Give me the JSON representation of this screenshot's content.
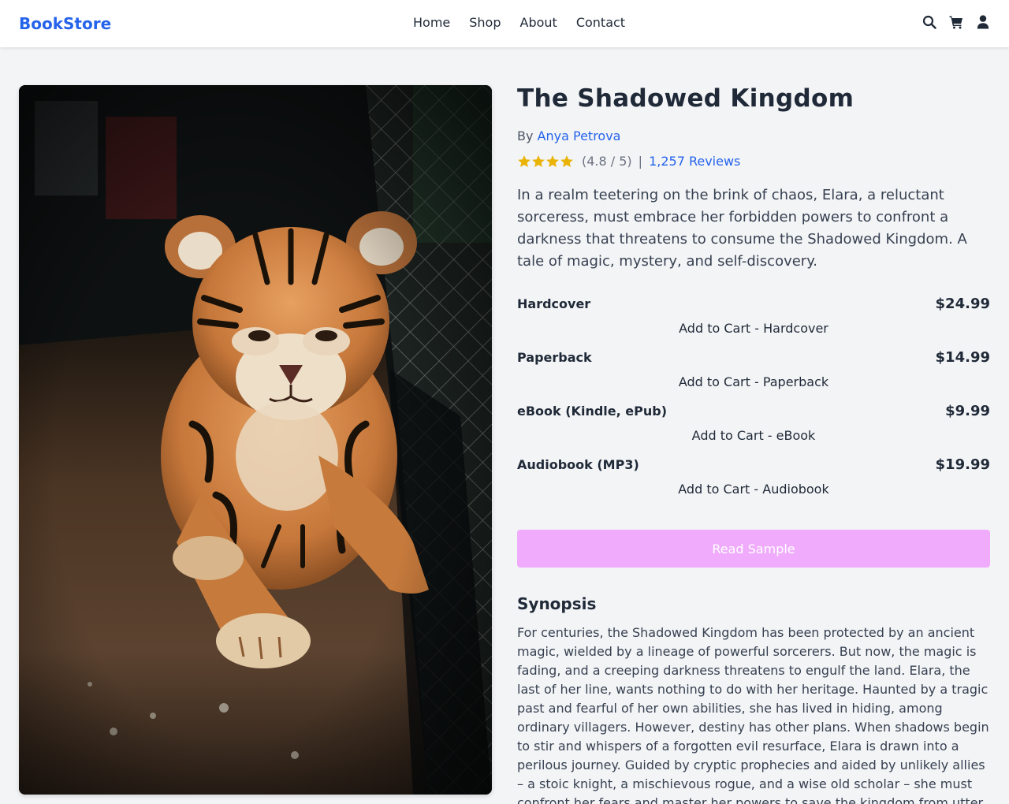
{
  "header": {
    "logo": "BookStore",
    "nav": [
      "Home",
      "Shop",
      "About",
      "Contact"
    ],
    "icons": [
      "search-icon",
      "cart-icon",
      "user-icon"
    ]
  },
  "book": {
    "title": "The Shadowed Kingdom",
    "by_label": "By",
    "author": "Anya Petrova",
    "rating_stars": 4,
    "rating_text": "(4.8 / 5)",
    "separator": "|",
    "reviews": "1,257 Reviews",
    "description": "In a realm teetering on the brink of chaos, Elara, a reluctant sorceress, must embrace her forbidden powers to confront a darkness that threatens to consume the Shadowed Kingdom. A tale of magic, mystery, and self-discovery.",
    "cover_image": "tiger cub lying on dirt floor beside chain-link fence"
  },
  "formats": [
    {
      "name": "Hardcover",
      "price": "$24.99",
      "button": "Add to Cart - Hardcover"
    },
    {
      "name": "Paperback",
      "price": "$14.99",
      "button": "Add to Cart - Paperback"
    },
    {
      "name": "eBook (Kindle, ePub)",
      "price": "$9.99",
      "button": "Add to Cart - eBook"
    },
    {
      "name": "Audiobook (MP3)",
      "price": "$19.99",
      "button": "Add to Cart - Audiobook"
    }
  ],
  "read_sample": "Read Sample",
  "synopsis": {
    "heading": "Synopsis",
    "text": "For centuries, the Shadowed Kingdom has been protected by an ancient magic, wielded by a lineage of powerful sorcerers. But now, the magic is fading, and a creeping darkness threatens to engulf the land. Elara, the last of her line, wants nothing to do with her heritage. Haunted by a tragic past and fearful of her own abilities, she has lived in hiding, among ordinary villagers. However, destiny has other plans. When shadows begin to stir and whispers of a forgotten evil resurface, Elara is drawn into a perilous journey. Guided by cryptic prophecies and aided by unlikely allies – a stoic knight, a mischievous rogue, and a wise old scholar – she must confront her fears and master her powers to save the kingdom from utter"
  },
  "colors": {
    "accent": "#2563eb",
    "star": "#eab308",
    "sample_button": "#f0abfc",
    "background": "#f3f4f6"
  }
}
